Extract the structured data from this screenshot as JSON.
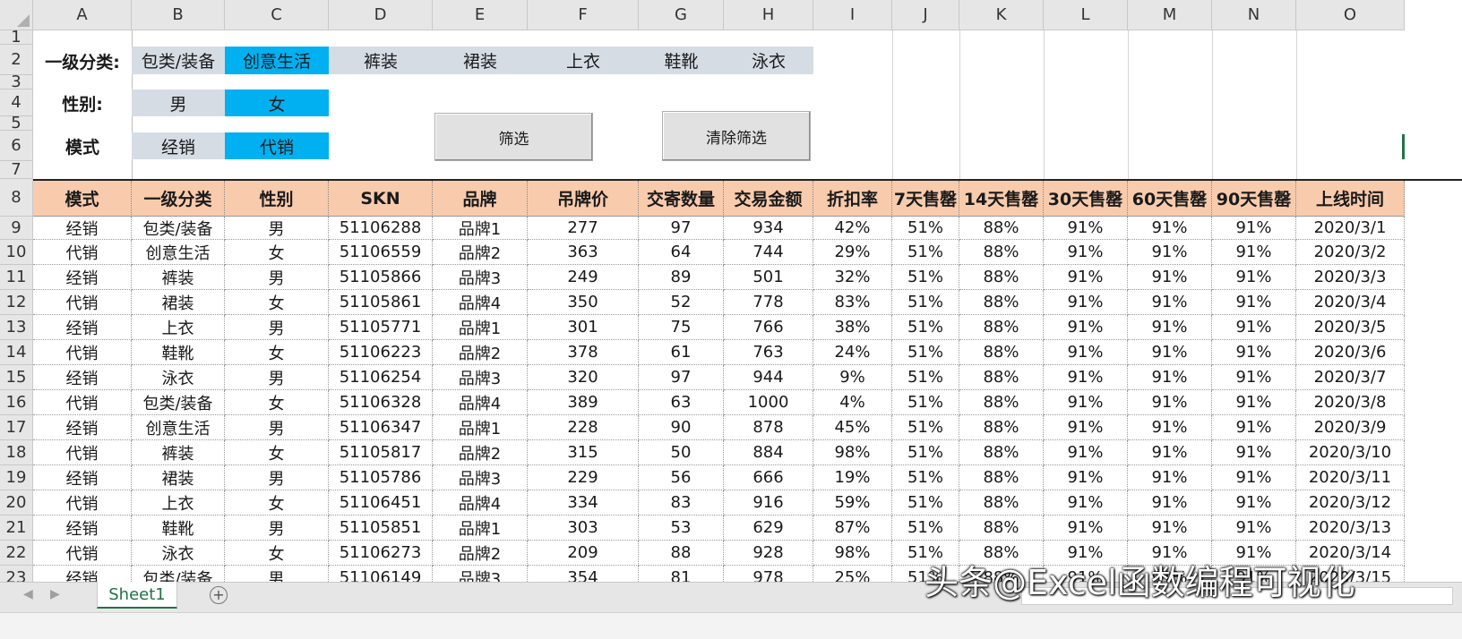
{
  "columns": [
    "A",
    "B",
    "C",
    "D",
    "E",
    "F",
    "G",
    "H",
    "I",
    "J",
    "K",
    "L",
    "M",
    "N",
    "O"
  ],
  "rows": [
    "1",
    "2",
    "3",
    "4",
    "5",
    "6",
    "7",
    "8",
    "9",
    "10",
    "11",
    "12",
    "13",
    "14",
    "15",
    "16",
    "17",
    "18",
    "19",
    "20",
    "21",
    "22",
    "23"
  ],
  "filters": {
    "category_label": "一级分类:",
    "category_options": [
      "包类/装备",
      "创意生活",
      "裤装",
      "裙装",
      "上衣",
      "鞋靴",
      "泳衣"
    ],
    "category_selected": "创意生活",
    "gender_label": "性别:",
    "gender_options": [
      "男",
      "女"
    ],
    "gender_selected": "女",
    "mode_label": "模式",
    "mode_options": [
      "经销",
      "代销"
    ],
    "mode_selected": "代销"
  },
  "buttons": {
    "filter": "筛选",
    "clear": "清除筛选"
  },
  "table": {
    "headers": [
      "模式",
      "一级分类",
      "性别",
      "SKN",
      "品牌",
      "吊牌价",
      "交寄数量",
      "交易金额",
      "折扣率",
      "7天售罄",
      "14天售罄",
      "30天售罄",
      "60天售罄",
      "90天售罄",
      "上线时间"
    ],
    "rows": [
      [
        "经销",
        "包类/装备",
        "男",
        "51106288",
        "品牌1",
        "277",
        "97",
        "934",
        "42%",
        "51%",
        "88%",
        "91%",
        "91%",
        "91%",
        "2020/3/1"
      ],
      [
        "代销",
        "创意生活",
        "女",
        "51106559",
        "品牌2",
        "363",
        "64",
        "744",
        "29%",
        "51%",
        "88%",
        "91%",
        "91%",
        "91%",
        "2020/3/2"
      ],
      [
        "经销",
        "裤装",
        "男",
        "51105866",
        "品牌3",
        "249",
        "89",
        "501",
        "32%",
        "51%",
        "88%",
        "91%",
        "91%",
        "91%",
        "2020/3/3"
      ],
      [
        "代销",
        "裙装",
        "女",
        "51105861",
        "品牌4",
        "350",
        "52",
        "778",
        "83%",
        "51%",
        "88%",
        "91%",
        "91%",
        "91%",
        "2020/3/4"
      ],
      [
        "经销",
        "上衣",
        "男",
        "51105771",
        "品牌1",
        "301",
        "75",
        "766",
        "38%",
        "51%",
        "88%",
        "91%",
        "91%",
        "91%",
        "2020/3/5"
      ],
      [
        "代销",
        "鞋靴",
        "女",
        "51106223",
        "品牌2",
        "378",
        "61",
        "763",
        "24%",
        "51%",
        "88%",
        "91%",
        "91%",
        "91%",
        "2020/3/6"
      ],
      [
        "经销",
        "泳衣",
        "男",
        "51106254",
        "品牌3",
        "320",
        "97",
        "944",
        "9%",
        "51%",
        "88%",
        "91%",
        "91%",
        "91%",
        "2020/3/7"
      ],
      [
        "代销",
        "包类/装备",
        "女",
        "51106328",
        "品牌4",
        "389",
        "63",
        "1000",
        "4%",
        "51%",
        "88%",
        "91%",
        "91%",
        "91%",
        "2020/3/8"
      ],
      [
        "经销",
        "创意生活",
        "男",
        "51106347",
        "品牌1",
        "228",
        "90",
        "878",
        "45%",
        "51%",
        "88%",
        "91%",
        "91%",
        "91%",
        "2020/3/9"
      ],
      [
        "代销",
        "裤装",
        "女",
        "51105817",
        "品牌2",
        "315",
        "50",
        "884",
        "98%",
        "51%",
        "88%",
        "91%",
        "91%",
        "91%",
        "2020/3/10"
      ],
      [
        "经销",
        "裙装",
        "男",
        "51105786",
        "品牌3",
        "229",
        "56",
        "666",
        "19%",
        "51%",
        "88%",
        "91%",
        "91%",
        "91%",
        "2020/3/11"
      ],
      [
        "代销",
        "上衣",
        "女",
        "51106451",
        "品牌4",
        "334",
        "83",
        "916",
        "59%",
        "51%",
        "88%",
        "91%",
        "91%",
        "91%",
        "2020/3/12"
      ],
      [
        "经销",
        "鞋靴",
        "男",
        "51105851",
        "品牌1",
        "303",
        "53",
        "629",
        "87%",
        "51%",
        "88%",
        "91%",
        "91%",
        "91%",
        "2020/3/13"
      ],
      [
        "代销",
        "泳衣",
        "女",
        "51106273",
        "品牌2",
        "209",
        "88",
        "928",
        "98%",
        "51%",
        "88%",
        "91%",
        "91%",
        "91%",
        "2020/3/14"
      ],
      [
        "经销",
        "包类/装备",
        "男",
        "51106149",
        "品牌3",
        "354",
        "81",
        "978",
        "25%",
        "51%",
        "88%",
        "91%",
        "91%",
        "91%",
        "2020/3/15"
      ]
    ]
  },
  "sheet_tab": "Sheet1",
  "add_sheet_icon": "plus-circle-icon",
  "watermark": "头条@Excel函数编程可视化",
  "colors": {
    "header_fill": "#f8cbad",
    "chip_gray": "#d6dce4",
    "chip_selected": "#00b0f0",
    "sheet_tab_accent": "#217346"
  }
}
